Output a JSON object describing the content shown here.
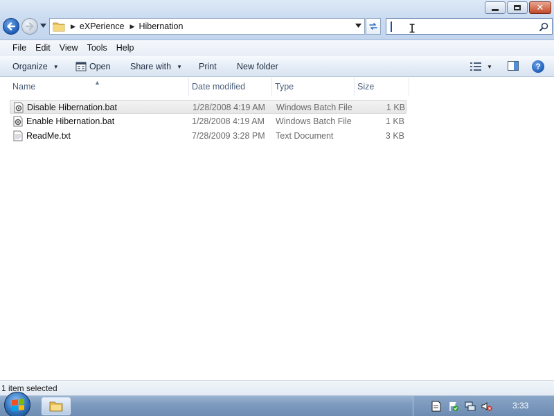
{
  "window": {
    "minimize_icon": "minimize-icon",
    "maximize_icon": "restore-icon",
    "close_icon": "close-icon"
  },
  "address": {
    "crumbs": [
      "eXPerience",
      "Hibernation"
    ]
  },
  "search": {
    "placeholder": "",
    "value": ""
  },
  "menu": {
    "items": [
      "File",
      "Edit",
      "View",
      "Tools",
      "Help"
    ]
  },
  "commands": {
    "organize": "Organize",
    "open": "Open",
    "share_with": "Share with",
    "print": "Print",
    "new_folder": "New folder"
  },
  "columns": {
    "name": "Name",
    "date_modified": "Date modified",
    "type": "Type",
    "size": "Size"
  },
  "files": [
    {
      "name": "Disable Hibernation.bat",
      "date": "1/28/2008 4:19 AM",
      "type": "Windows Batch File",
      "size": "1 KB",
      "icon": "batch-file-icon",
      "selected": true
    },
    {
      "name": "Enable Hibernation.bat",
      "date": "1/28/2008 4:19 AM",
      "type": "Windows Batch File",
      "size": "1 KB",
      "icon": "batch-file-icon",
      "selected": false
    },
    {
      "name": "ReadMe.txt",
      "date": "7/28/2009 3:28 PM",
      "type": "Text Document",
      "size": "3 KB",
      "icon": "text-file-icon",
      "selected": false
    }
  ],
  "status": {
    "text": "1 item selected"
  },
  "taskbar": {
    "clock": "3:33",
    "colors": {
      "taskbar": "#7e9bbf",
      "accent": "#1f5db8"
    }
  }
}
